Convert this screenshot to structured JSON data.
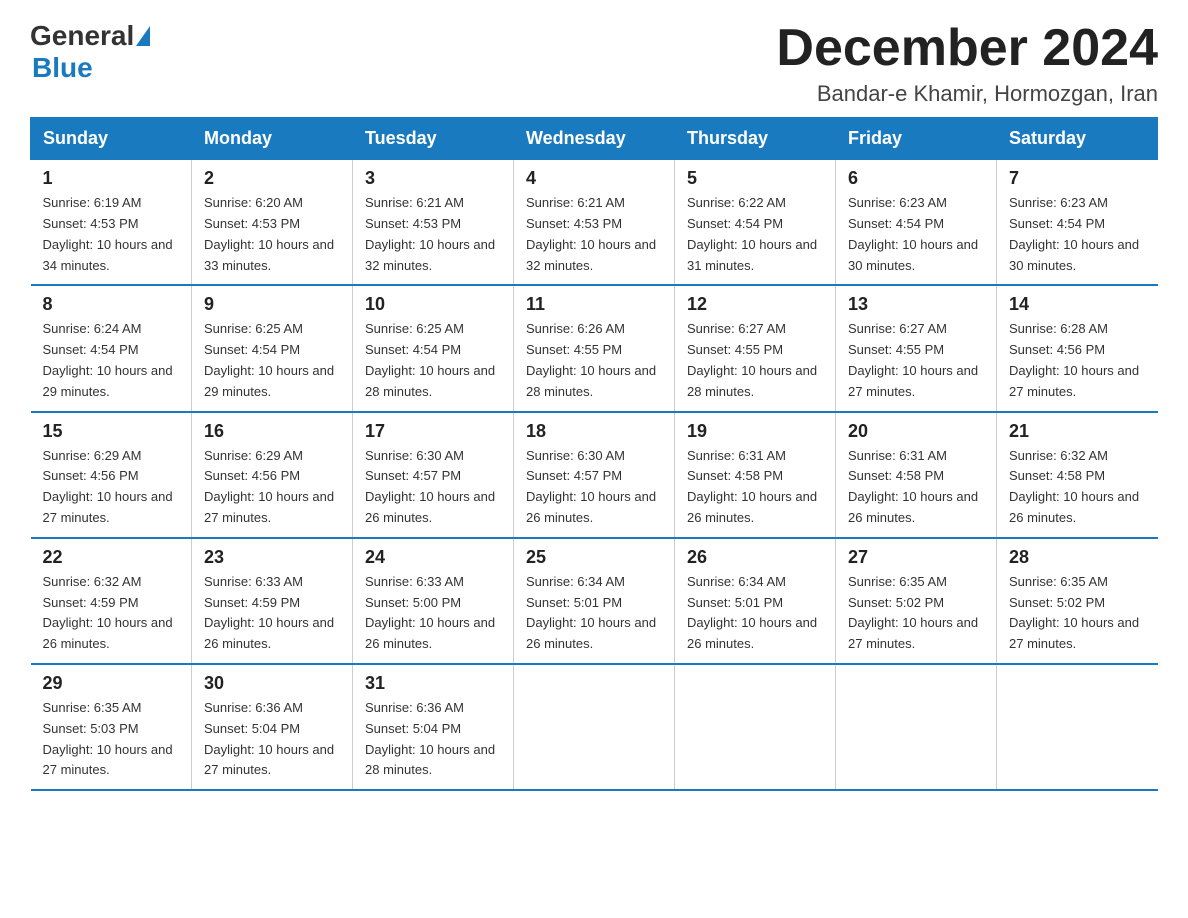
{
  "logo": {
    "general": "General",
    "blue": "Blue"
  },
  "header": {
    "month_year": "December 2024",
    "location": "Bandar-e Khamir, Hormozgan, Iran"
  },
  "weekdays": [
    "Sunday",
    "Monday",
    "Tuesday",
    "Wednesday",
    "Thursday",
    "Friday",
    "Saturday"
  ],
  "weeks": [
    [
      {
        "day": "1",
        "sunrise": "6:19 AM",
        "sunset": "4:53 PM",
        "daylight": "10 hours and 34 minutes."
      },
      {
        "day": "2",
        "sunrise": "6:20 AM",
        "sunset": "4:53 PM",
        "daylight": "10 hours and 33 minutes."
      },
      {
        "day": "3",
        "sunrise": "6:21 AM",
        "sunset": "4:53 PM",
        "daylight": "10 hours and 32 minutes."
      },
      {
        "day": "4",
        "sunrise": "6:21 AM",
        "sunset": "4:53 PM",
        "daylight": "10 hours and 32 minutes."
      },
      {
        "day": "5",
        "sunrise": "6:22 AM",
        "sunset": "4:54 PM",
        "daylight": "10 hours and 31 minutes."
      },
      {
        "day": "6",
        "sunrise": "6:23 AM",
        "sunset": "4:54 PM",
        "daylight": "10 hours and 30 minutes."
      },
      {
        "day": "7",
        "sunrise": "6:23 AM",
        "sunset": "4:54 PM",
        "daylight": "10 hours and 30 minutes."
      }
    ],
    [
      {
        "day": "8",
        "sunrise": "6:24 AM",
        "sunset": "4:54 PM",
        "daylight": "10 hours and 29 minutes."
      },
      {
        "day": "9",
        "sunrise": "6:25 AM",
        "sunset": "4:54 PM",
        "daylight": "10 hours and 29 minutes."
      },
      {
        "day": "10",
        "sunrise": "6:25 AM",
        "sunset": "4:54 PM",
        "daylight": "10 hours and 28 minutes."
      },
      {
        "day": "11",
        "sunrise": "6:26 AM",
        "sunset": "4:55 PM",
        "daylight": "10 hours and 28 minutes."
      },
      {
        "day": "12",
        "sunrise": "6:27 AM",
        "sunset": "4:55 PM",
        "daylight": "10 hours and 28 minutes."
      },
      {
        "day": "13",
        "sunrise": "6:27 AM",
        "sunset": "4:55 PM",
        "daylight": "10 hours and 27 minutes."
      },
      {
        "day": "14",
        "sunrise": "6:28 AM",
        "sunset": "4:56 PM",
        "daylight": "10 hours and 27 minutes."
      }
    ],
    [
      {
        "day": "15",
        "sunrise": "6:29 AM",
        "sunset": "4:56 PM",
        "daylight": "10 hours and 27 minutes."
      },
      {
        "day": "16",
        "sunrise": "6:29 AM",
        "sunset": "4:56 PM",
        "daylight": "10 hours and 27 minutes."
      },
      {
        "day": "17",
        "sunrise": "6:30 AM",
        "sunset": "4:57 PM",
        "daylight": "10 hours and 26 minutes."
      },
      {
        "day": "18",
        "sunrise": "6:30 AM",
        "sunset": "4:57 PM",
        "daylight": "10 hours and 26 minutes."
      },
      {
        "day": "19",
        "sunrise": "6:31 AM",
        "sunset": "4:58 PM",
        "daylight": "10 hours and 26 minutes."
      },
      {
        "day": "20",
        "sunrise": "6:31 AM",
        "sunset": "4:58 PM",
        "daylight": "10 hours and 26 minutes."
      },
      {
        "day": "21",
        "sunrise": "6:32 AM",
        "sunset": "4:58 PM",
        "daylight": "10 hours and 26 minutes."
      }
    ],
    [
      {
        "day": "22",
        "sunrise": "6:32 AM",
        "sunset": "4:59 PM",
        "daylight": "10 hours and 26 minutes."
      },
      {
        "day": "23",
        "sunrise": "6:33 AM",
        "sunset": "4:59 PM",
        "daylight": "10 hours and 26 minutes."
      },
      {
        "day": "24",
        "sunrise": "6:33 AM",
        "sunset": "5:00 PM",
        "daylight": "10 hours and 26 minutes."
      },
      {
        "day": "25",
        "sunrise": "6:34 AM",
        "sunset": "5:01 PM",
        "daylight": "10 hours and 26 minutes."
      },
      {
        "day": "26",
        "sunrise": "6:34 AM",
        "sunset": "5:01 PM",
        "daylight": "10 hours and 26 minutes."
      },
      {
        "day": "27",
        "sunrise": "6:35 AM",
        "sunset": "5:02 PM",
        "daylight": "10 hours and 27 minutes."
      },
      {
        "day": "28",
        "sunrise": "6:35 AM",
        "sunset": "5:02 PM",
        "daylight": "10 hours and 27 minutes."
      }
    ],
    [
      {
        "day": "29",
        "sunrise": "6:35 AM",
        "sunset": "5:03 PM",
        "daylight": "10 hours and 27 minutes."
      },
      {
        "day": "30",
        "sunrise": "6:36 AM",
        "sunset": "5:04 PM",
        "daylight": "10 hours and 27 minutes."
      },
      {
        "day": "31",
        "sunrise": "6:36 AM",
        "sunset": "5:04 PM",
        "daylight": "10 hours and 28 minutes."
      },
      null,
      null,
      null,
      null
    ]
  ],
  "labels": {
    "sunrise": "Sunrise: ",
    "sunset": "Sunset: ",
    "daylight": "Daylight: "
  }
}
